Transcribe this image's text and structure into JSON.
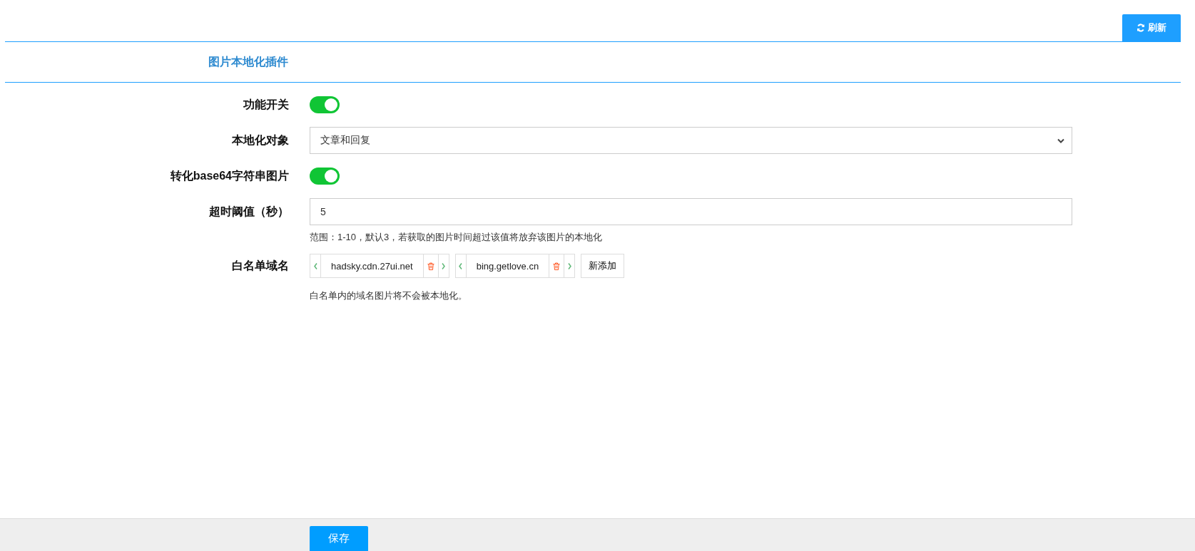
{
  "toolbar": {
    "refresh_button": "刷新"
  },
  "section_title": "图片本地化插件",
  "fields": [
    {
      "kind": "switch",
      "label": "功能开关",
      "on": true
    },
    {
      "kind": "select",
      "label": "本地化对象",
      "value": "文章和回复"
    },
    {
      "kind": "switch",
      "label": "转化base64字符串图片",
      "on": true
    },
    {
      "kind": "input",
      "label": "超时阈值（秒）",
      "value": "5",
      "hint": "范围：1-10，默认3，若获取的图片时间超过该值将放弃该图片的本地化"
    },
    {
      "kind": "tags",
      "label": "白名单域名",
      "tags": [
        "hadsky.cdn.27ui.net",
        "bing.getlove.cn"
      ],
      "add_button": "新添加",
      "hint": "白名单内的域名图片将不会被本地化。"
    }
  ],
  "footer": {
    "save_button": "保存"
  }
}
